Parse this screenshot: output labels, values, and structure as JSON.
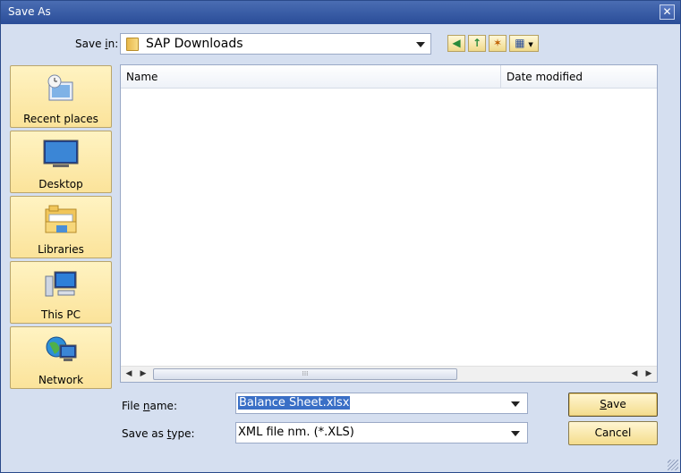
{
  "window": {
    "title": "Save As",
    "close_glyph": "✕"
  },
  "save_in": {
    "label_pre": "Save ",
    "label_key": "i",
    "label_post": "n:",
    "value": "SAP Downloads"
  },
  "toolbar": {
    "buttons": [
      {
        "name": "back-icon",
        "glyph": "◀"
      },
      {
        "name": "up-folder-icon",
        "glyph": "↑"
      },
      {
        "name": "new-folder-icon",
        "glyph": "✶"
      },
      {
        "name": "view-menu-icon",
        "glyph": "▦"
      }
    ]
  },
  "places": [
    {
      "label": "Recent places",
      "icon": "recent-places-icon"
    },
    {
      "label": "Desktop",
      "icon": "desktop-icon"
    },
    {
      "label": "Libraries",
      "icon": "libraries-icon"
    },
    {
      "label": "This PC",
      "icon": "computer-icon"
    },
    {
      "label": "Network",
      "icon": "network-icon"
    }
  ],
  "file_list": {
    "columns": [
      "Name",
      "Date modified"
    ],
    "rows": [],
    "scroll_left": "◀",
    "scroll_right": "▶",
    "thumb_grip": "⁞⁞⁞"
  },
  "file_name": {
    "label_pre": "File ",
    "label_key": "n",
    "label_post": "ame:",
    "value": "Balance Sheet.xlsx"
  },
  "save_type": {
    "label_pre": "Save as ",
    "label_key": "t",
    "label_post": "ype:",
    "value": "XML file nm. (*.XLS)"
  },
  "buttons": {
    "save_key": "S",
    "save_rest": "ave",
    "cancel": "Cancel"
  },
  "colors": {
    "title_bar": "#2a4d98",
    "dialog_background": "#d5dff0",
    "selection": "#3a6fc6",
    "button_fill": "#fbe39a"
  }
}
